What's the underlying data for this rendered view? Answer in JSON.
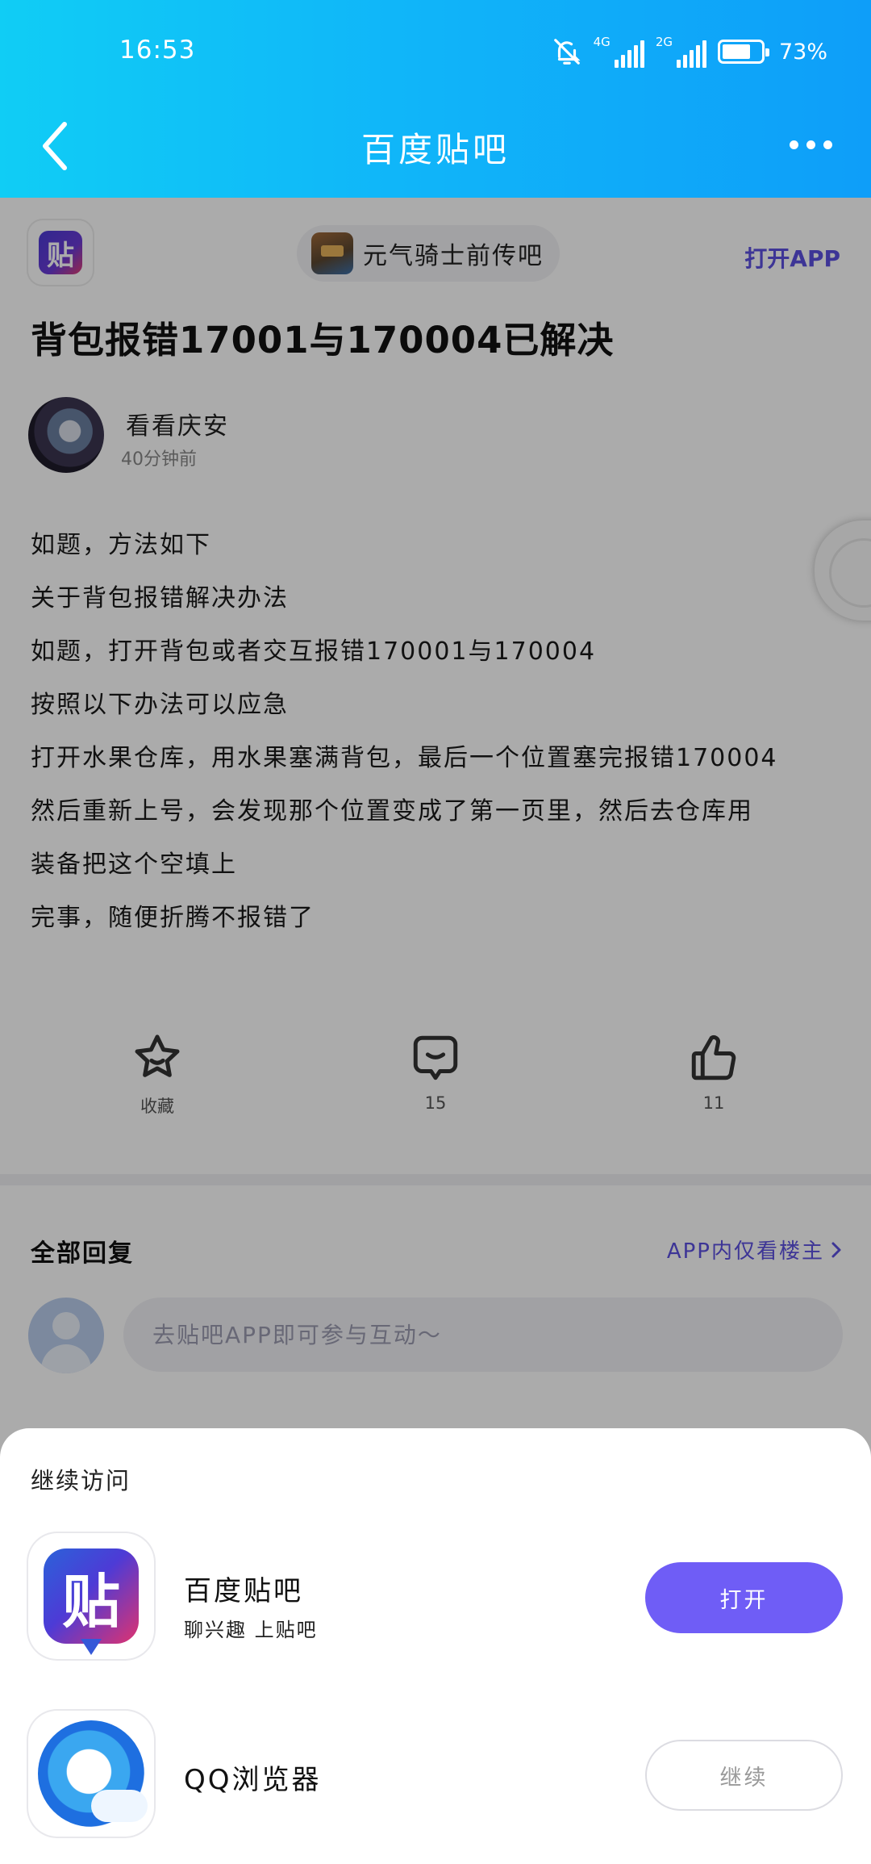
{
  "status_bar": {
    "time": "16:53",
    "network_1": "4G",
    "network_2": "2G",
    "battery_level": 0.73,
    "battery_pct": "73%"
  },
  "header": {
    "title": "百度贴吧",
    "back_icon": "chevron-left-icon",
    "more_icon": "more-dots-icon"
  },
  "top_row": {
    "forum_name": "元气骑士前传吧",
    "open_app": "打开APP"
  },
  "post": {
    "title": "背包报错17001与170004已解决",
    "author": "看看庆安",
    "time": "40分钟前",
    "body_lines": [
      "如题，方法如下",
      "关于背包报错解决办法",
      "如题，打开背包或者交互报错170001与170004",
      "按照以下办法可以应急",
      "打开水果仓库，用水果塞满背包，最后一个位置塞完报错170004",
      "然后重新上号，会发现那个位置变成了第一页里，然后去仓库用",
      "装备把这个空填上",
      "完事，随便折腾不报错了"
    ]
  },
  "actions": {
    "favorite_label": "收藏",
    "comment_count": "15",
    "like_count": "11"
  },
  "replies": {
    "header": "全部回复",
    "only_op": "APP内仅看楼主",
    "input_placeholder": "去贴吧APP即可参与互动～"
  },
  "sheet": {
    "title": "继续访问",
    "apps": [
      {
        "name": "百度贴吧",
        "desc": "聊兴趣 上贴吧",
        "button": "打开",
        "icon_glyph": "贴"
      },
      {
        "name": "QQ浏览器",
        "button": "继续"
      }
    ]
  },
  "colors": {
    "header_start": "#10cdf5",
    "header_end": "#0e9ef9",
    "accent_purple": "#6f5df6",
    "link_purple": "#5b4fe0"
  }
}
